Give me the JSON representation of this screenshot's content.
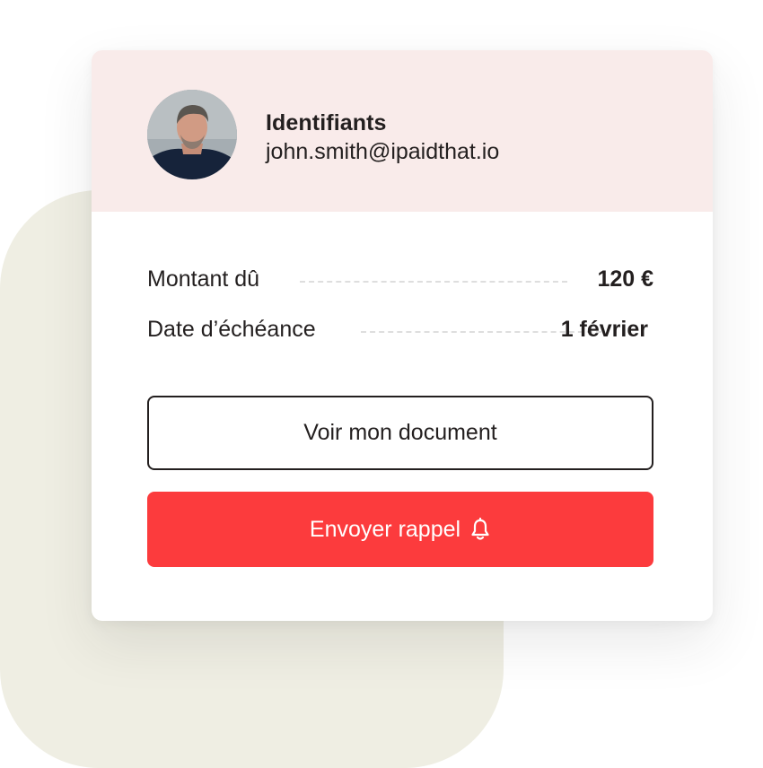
{
  "profile": {
    "title": "Identifiants",
    "email": "john.smith@ipaidthat.io"
  },
  "details": {
    "amount_label": "Montant dû",
    "amount_value": "120 €",
    "due_label": "Date d’échéance",
    "due_value": "1 février"
  },
  "actions": {
    "view_label": "Voir mon document",
    "remind_label": "Envoyer rappel",
    "remind_icon": "bell-icon"
  },
  "colors": {
    "header_bg": "#f9ebea",
    "accent_red": "#fc3b3d",
    "backdrop": "#efeee3",
    "text": "#231f1f"
  }
}
